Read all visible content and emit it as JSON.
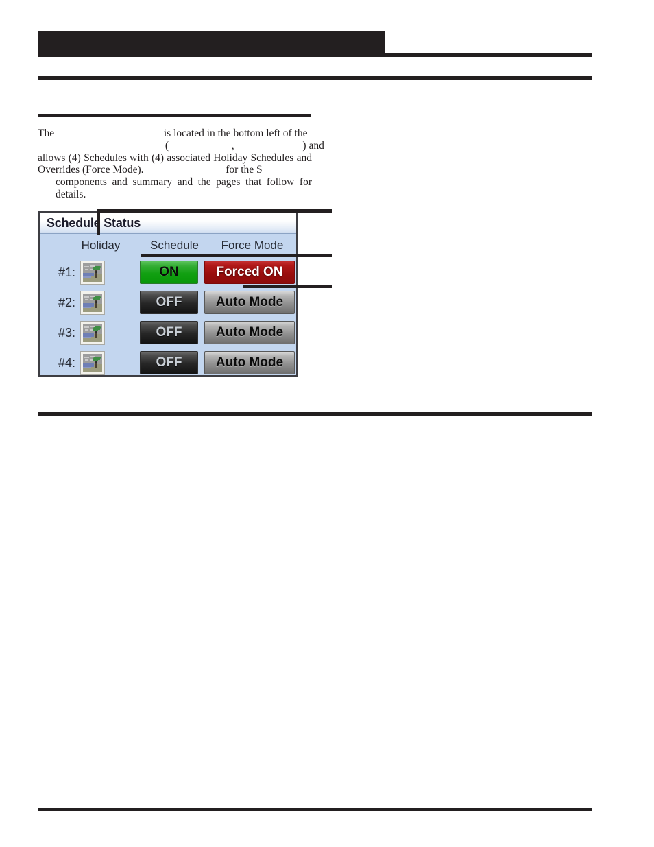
{
  "page": {
    "header_bar_label": "",
    "body_text": {
      "line1_a": "The",
      "line1_redacted_1": "",
      "line1_b": "is located in the bottom left of the",
      "line2_open_paren": "(",
      "line2_redacted_1": "",
      "line2_comma": ",",
      "line2_redacted_2": "",
      "line2_close": ") and",
      "line3": "allows (4) Schedules with (4) associated Holiday Schedules and",
      "line4_a": "Overrides (Force Mode).",
      "line4_redacted": "",
      "line4_b": "for the S",
      "line5": "components and summary and the pages that follow for details."
    }
  },
  "figure": {
    "panel": {
      "title": "Schedule Status",
      "columns": {
        "holiday": "Holiday",
        "schedule": "Schedule",
        "force_mode": "Force Mode"
      },
      "rows": [
        {
          "label": "#1:",
          "holiday_icon": "holiday-beach-icon",
          "schedule_state": "ON",
          "schedule_state_style": "on",
          "force_mode": "Forced ON",
          "force_mode_style": "forced-on"
        },
        {
          "label": "#2:",
          "holiday_icon": "holiday-beach-icon",
          "schedule_state": "OFF",
          "schedule_state_style": "off",
          "force_mode": "Auto Mode",
          "force_mode_style": "auto"
        },
        {
          "label": "#3:",
          "holiday_icon": "holiday-beach-icon",
          "schedule_state": "OFF",
          "schedule_state_style": "off",
          "force_mode": "Auto Mode",
          "force_mode_style": "auto"
        },
        {
          "label": "#4:",
          "holiday_icon": "holiday-beach-icon",
          "schedule_state": "OFF",
          "schedule_state_style": "off",
          "force_mode": "Auto Mode",
          "force_mode_style": "auto"
        }
      ]
    },
    "callouts": [
      {
        "id": "callout-title",
        "label": ""
      },
      {
        "id": "callout-schedule-state",
        "label": ""
      },
      {
        "id": "callout-force-mode",
        "label": ""
      }
    ]
  },
  "colors": {
    "ink": "#231f20",
    "panel_background": "#c3d6ef",
    "panel_border": "#3d3d42",
    "on_green": "#12a012",
    "forced_on_red": "#980d0d",
    "off_dark": "#262626",
    "auto_gray": "#8e8e8e"
  }
}
